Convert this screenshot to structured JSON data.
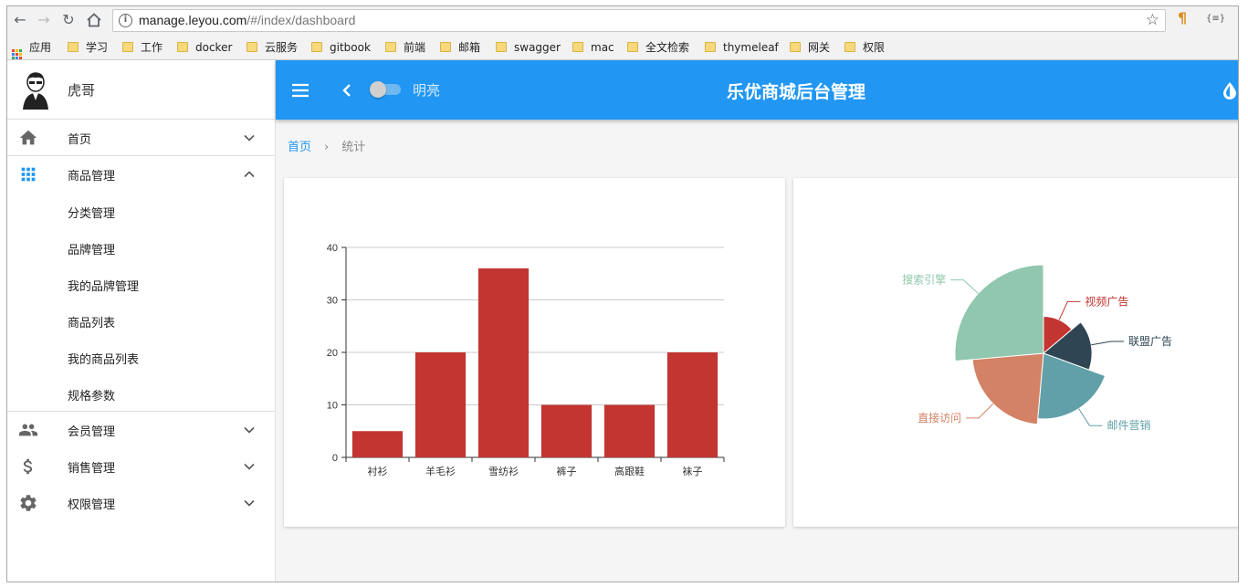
{
  "browser": {
    "url_host": "manage.leyou.com",
    "url_rest": "/#/index/dashboard",
    "ext1": "¶",
    "ext2": "{≡}",
    "bookmarks": [
      {
        "label": "应用",
        "icon": "apps-icon"
      },
      {
        "label": "学习",
        "icon": "folder-icon"
      },
      {
        "label": "工作",
        "icon": "folder-icon"
      },
      {
        "label": "docker",
        "icon": "folder-icon"
      },
      {
        "label": "云服务",
        "icon": "folder-icon"
      },
      {
        "label": "gitbook",
        "icon": "folder-icon"
      },
      {
        "label": "前端",
        "icon": "folder-icon"
      },
      {
        "label": "邮箱",
        "icon": "folder-icon"
      },
      {
        "label": "swagger",
        "icon": "folder-icon"
      },
      {
        "label": "mac",
        "icon": "folder-icon"
      },
      {
        "label": "全文检索",
        "icon": "folder-icon"
      },
      {
        "label": "thymeleaf",
        "icon": "folder-icon"
      },
      {
        "label": "网关",
        "icon": "folder-icon"
      },
      {
        "label": "权限",
        "icon": "folder-icon"
      }
    ]
  },
  "sidebar": {
    "username": "虎哥",
    "items": [
      {
        "label": "首页",
        "icon": "home-icon",
        "expanded": false
      },
      {
        "label": "商品管理",
        "icon": "apps-grid-icon",
        "expanded": true,
        "children": [
          "分类管理",
          "品牌管理",
          "我的品牌管理",
          "商品列表",
          "我的商品列表",
          "规格参数"
        ]
      },
      {
        "label": "会员管理",
        "icon": "people-icon",
        "expanded": false
      },
      {
        "label": "销售管理",
        "icon": "dollar-icon",
        "expanded": false
      },
      {
        "label": "权限管理",
        "icon": "gear-icon",
        "expanded": false
      }
    ]
  },
  "header": {
    "mode_label": "明亮",
    "title": "乐优商城后台管理",
    "theme_toggle_on": false
  },
  "breadcrumb": {
    "home": "首页",
    "current": "统计"
  },
  "colors": {
    "primary": "#2196f3",
    "bar": "#c23531"
  },
  "chart_data": [
    {
      "type": "bar",
      "categories": [
        "衬衫",
        "羊毛衫",
        "雪纺衫",
        "裤子",
        "高跟鞋",
        "袜子"
      ],
      "values": [
        5,
        20,
        36,
        10,
        10,
        20
      ],
      "ylim": [
        0,
        40
      ],
      "yticks": [
        0,
        10,
        20,
        30,
        40
      ],
      "grid": true,
      "color": "#c23531"
    },
    {
      "type": "pie",
      "rose": true,
      "slices": [
        {
          "name": "视频广告",
          "value": 10,
          "color": "#c23531"
        },
        {
          "name": "联盟广告",
          "value": 12,
          "color": "#2f4554"
        },
        {
          "name": "邮件营销",
          "value": 15,
          "color": "#61a0a8"
        },
        {
          "name": "直接访问",
          "value": 16,
          "color": "#d48265"
        },
        {
          "name": "搜索引擎",
          "value": 19,
          "color": "#91c7ae"
        }
      ]
    }
  ]
}
